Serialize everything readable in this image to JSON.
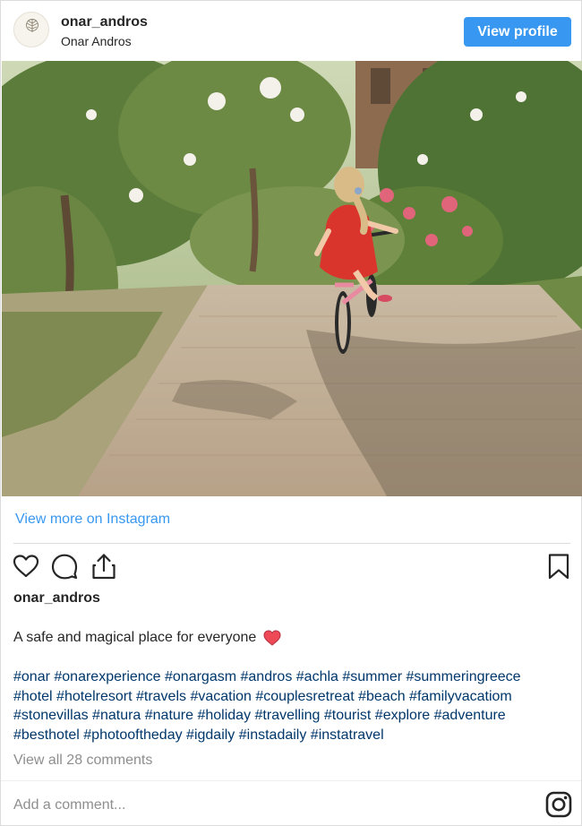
{
  "header": {
    "username": "onar_andros",
    "full_name": "Onar Andros",
    "avatar_text": "ONAR",
    "view_profile_label": "View profile"
  },
  "photo": {
    "alt": "Girl in red dress riding a bicycle on a stone path"
  },
  "link": {
    "view_more_label": "View more on Instagram"
  },
  "actions": {
    "icons": [
      "heart-icon",
      "comment-icon",
      "share-icon",
      "bookmark-icon"
    ]
  },
  "post": {
    "owner": "onar_andros",
    "caption": "A safe and magical place for everyone",
    "caption_emoji": "heart-icon",
    "hashtag_lines": [
      "#onar #onarexperience #onargasm #andros #achla #summer #summeringreece",
      "#hotel #hotelresort #travels #vacation #couplesretreat #beach #familyvacatiom",
      "#stonevillas #natura #nature #holiday #travelling #tourist #explore #adventure",
      "#besthotel #photooftheday #igdaily #instadaily #instatravel"
    ],
    "view_comments_label": "View all 28 comments"
  },
  "comment_box": {
    "placeholder": "Add a comment..."
  },
  "colors": {
    "accent": "#3897f0",
    "hashtag": "#00376b",
    "muted": "#8e8e8e",
    "heart": "#ed4956"
  }
}
